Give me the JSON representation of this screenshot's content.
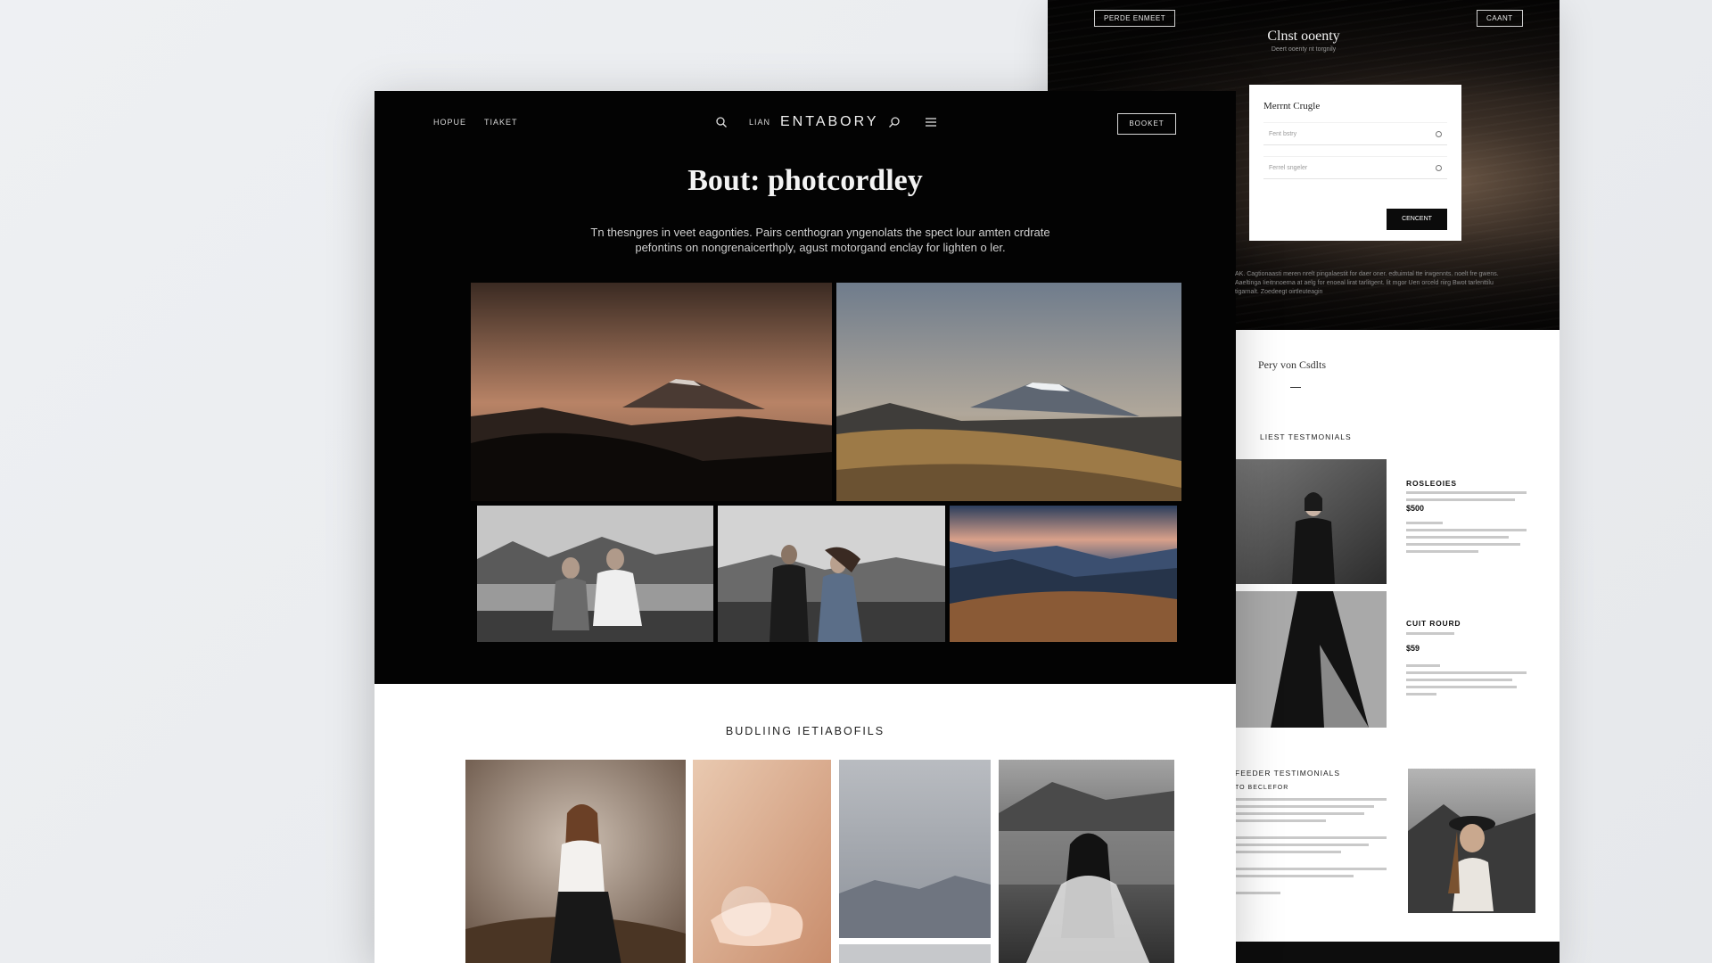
{
  "right_panel": {
    "top_left_button": "PERDE ENMEET",
    "top_right_button": "CAANT",
    "title": "Clnst ooenty",
    "subtitle": "Deert ooenty nt torgnily",
    "form": {
      "title": "Merrnt Crugle",
      "field1_placeholder": "Fent bstry",
      "field2_placeholder": "Ferrel sngeler",
      "submit_label": "CENCENT"
    },
    "intro_text": "AK. Cagtionaasti meren nrelt pingalaestit for daer oner. edtuimtal tte irwgennts. noelt fre gwens. Aaeltinga Iieitnnoerna at aelg for enoeal lirat tarlitgent. lit mgor Uen orceld riirg Bwot tarlenttilu tigarnalt. Zoedeegt oirtleuteagin",
    "services_title": "Pery von Csdlts",
    "testimonials_label": "LIEST TESTMONIALS",
    "product1": {
      "name": "ROSLEOIES",
      "price": "$500"
    },
    "product2": {
      "name": "CUIT ROURD",
      "price": "$59"
    },
    "lower_label": "FEEDER TESTIMONIALS",
    "lower_sub": "TO BECLEFOR"
  },
  "main": {
    "nav": {
      "home": "HOPUE",
      "travel": "TIAKET",
      "menu_item": "LIAN",
      "brand": "ENTABORY",
      "book": "BOOKET"
    },
    "hero_title": "Bout: photcordley",
    "hero_desc_line1": "Tn thesngres in veet eagonties. Pairs centhogran yngenolats the spect lour amten crdrate",
    "hero_desc_line2": "pefontins on nongrenaicerthply, agust motorgand enclay for lighten o ler.",
    "section_title": "BUDLIING IETIABOFILS"
  }
}
